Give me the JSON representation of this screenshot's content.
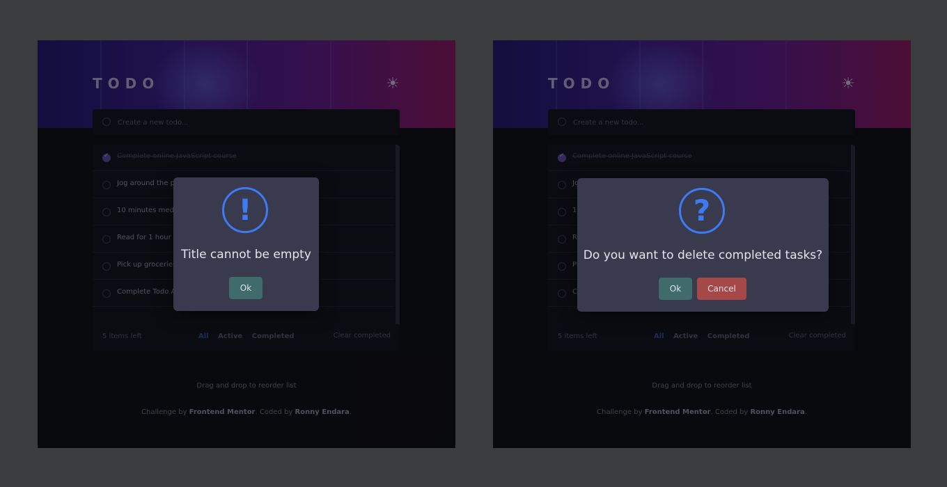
{
  "colors": {
    "accent": "#3e7bf3",
    "ok_button": "#3f6b6b",
    "cancel_button": "#a64848",
    "modal_bg": "#393a4e",
    "page_bg": "#3b3c3d",
    "app_bg": "#0f1016"
  },
  "app": {
    "title": "TODO",
    "theme_icon": "sun-icon",
    "theme_glyph": "☀",
    "new_todo_placeholder": "Create a new todo..."
  },
  "todos": [
    {
      "text": "Complete online JavaScript course",
      "completed": true
    },
    {
      "text": "Jog around the park 3x",
      "completed": false
    },
    {
      "text": "10 minutes meditation",
      "completed": false
    },
    {
      "text": "Read for 1 hour",
      "completed": false
    },
    {
      "text": "Pick up groceries",
      "completed": false
    },
    {
      "text": "Complete Todo App on Frontend Mentor",
      "completed": false
    }
  ],
  "footer": {
    "items_left": "5 items left",
    "filter_all": "All",
    "filter_active": "Active",
    "filter_completed": "Completed",
    "clear_completed": "Clear completed"
  },
  "hint": "Drag and drop to reorder list",
  "credit": {
    "prefix": "Challenge by ",
    "frontend_mentor": "Frontend Mentor",
    "middle": ". Coded by ",
    "author": "Ronny Endara",
    "suffix": "."
  },
  "modal_error": {
    "icon": "exclamation-icon",
    "icon_glyph": "!",
    "title": "Title cannot be empty",
    "ok_label": "Ok"
  },
  "modal_confirm": {
    "icon": "question-icon",
    "icon_glyph": "?",
    "title": "Do you want to delete completed tasks?",
    "ok_label": "Ok",
    "cancel_label": "Cancel"
  }
}
